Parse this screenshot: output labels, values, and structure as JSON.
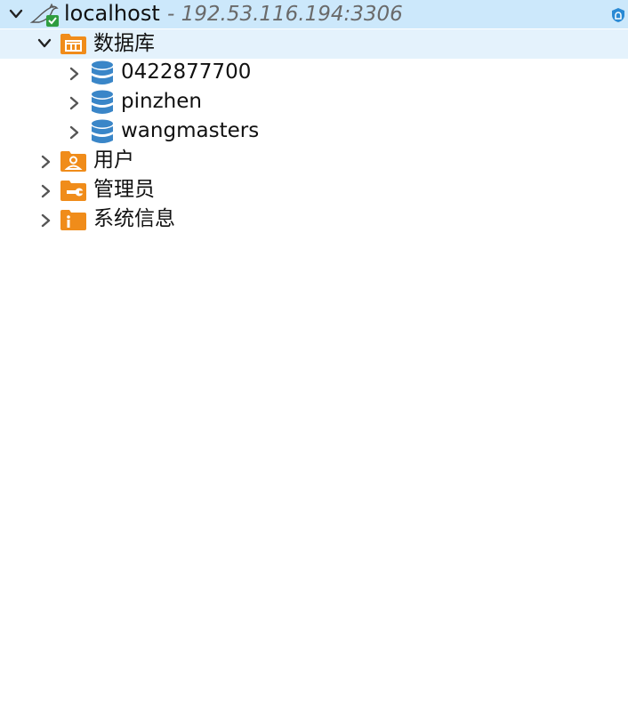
{
  "connection": {
    "name": "localhost",
    "address": "- 192.53.116.194:3306"
  },
  "tree": {
    "databases_folder": {
      "label": "数据库",
      "items": [
        {
          "label": "0422877700"
        },
        {
          "label": "pinzhen"
        },
        {
          "label": "wangmasters"
        }
      ]
    },
    "users_folder": {
      "label": "用户"
    },
    "admin_folder": {
      "label": "管理员"
    },
    "sysinfo_folder": {
      "label": "系统信息"
    }
  },
  "colors": {
    "connection_row_bg": "#cce8fb",
    "selected_row_bg": "#e4f2fc",
    "folder_orange": "#f08c1a",
    "database_blue": "#3a86c8",
    "address_gray": "#6a6a6a"
  },
  "icons": {
    "connection": "mysql-dolphin-icon",
    "databases": "database-folder-icon",
    "database": "database-icon",
    "users": "user-folder-icon",
    "admin": "wrench-folder-icon",
    "sysinfo": "info-folder-icon",
    "security": "shield-icon"
  }
}
